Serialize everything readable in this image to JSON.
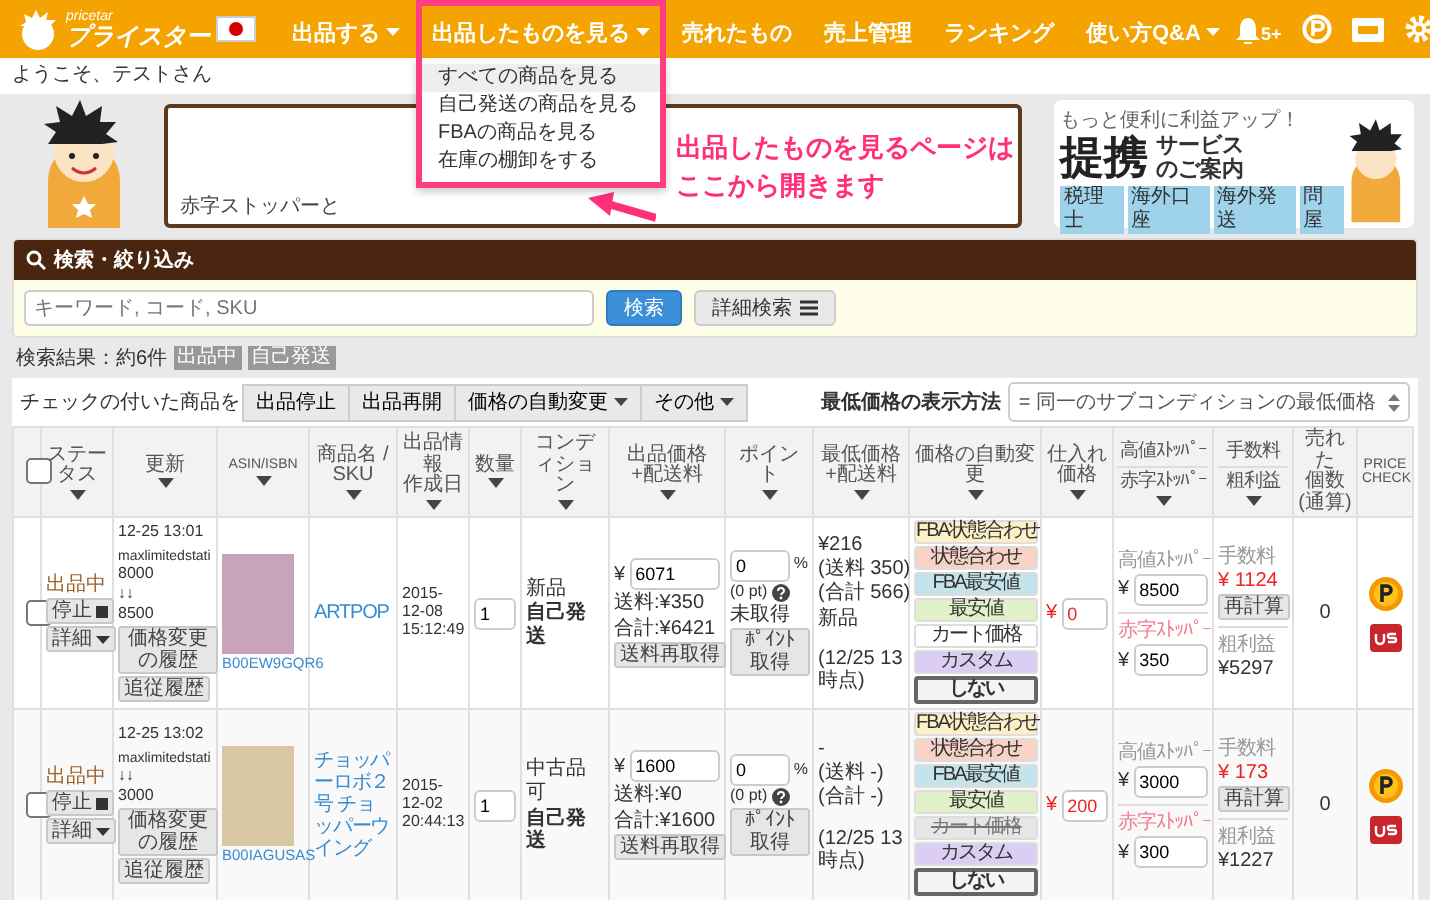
{
  "header": {
    "logo_tag": "pricetar",
    "logo": "プライスター",
    "nav": [
      {
        "label": "出品する",
        "dropdown": true,
        "expanded": false
      },
      {
        "label": "出品したものを見る",
        "dropdown": true,
        "expanded": true,
        "menu": [
          {
            "label": "すべての商品を見る",
            "selected": true
          },
          {
            "label": "自己発送の商品を見る",
            "selected": false
          },
          {
            "label": "FBAの商品を見る",
            "selected": false
          },
          {
            "label": "在庫の棚卸をする",
            "selected": false
          }
        ]
      },
      {
        "label": "売れたもの",
        "dropdown": false,
        "expanded": false
      },
      {
        "label": "売上管理",
        "dropdown": false,
        "expanded": false
      },
      {
        "label": "ランキング",
        "dropdown": false,
        "expanded": false
      },
      {
        "label": "使い方Q&A",
        "dropdown": true,
        "expanded": false
      }
    ],
    "notifications": "5+",
    "welcome": "ようこそ、テストさん"
  },
  "promo": {
    "bubble_text": "赤字ストッパーと",
    "callout": [
      "出品したものを見るページは",
      "ここから開きます"
    ],
    "banner": {
      "tagline": "もっと便利に利益アップ！",
      "title": "提携",
      "subtitle": [
        "サービス",
        "のご案内"
      ],
      "tags": [
        "税理士",
        "海外口座",
        "海外発送",
        "問屋"
      ]
    }
  },
  "search": {
    "title": "検索・絞り込み",
    "placeholder": "キーワード, コード, SKU",
    "search_button": "検索",
    "advanced_button": "詳細検索"
  },
  "results": {
    "count": "検索結果：約6件",
    "filters": [
      "出品中",
      "自己発送"
    ]
  },
  "toolbar": {
    "label": "チェックの付いた商品を",
    "actions": [
      {
        "label": "出品停止",
        "dropdown": false
      },
      {
        "label": "出品再開",
        "dropdown": false
      },
      {
        "label": "価格の自動変更",
        "dropdown": true
      },
      {
        "label": "その他",
        "dropdown": true
      }
    ],
    "display_label": "最低価格の表示方法",
    "display_value": "= 同一のサブコンディションの最低価格"
  },
  "table": {
    "select_all": {
      "checked": false
    },
    "columns": [
      {
        "lines": [
          "ステータス"
        ],
        "sortable": true
      },
      {
        "lines": [
          "更新"
        ],
        "sortable": true
      },
      {
        "lines": [
          "ASIN/ISBN"
        ],
        "sortable": true
      },
      {
        "lines": [
          "商品名 / SKU"
        ],
        "sortable": true
      },
      {
        "lines": [
          "出品情報",
          "作成日"
        ],
        "sortable": true
      },
      {
        "lines": [
          "数量"
        ],
        "sortable": true
      },
      {
        "lines": [
          "コンディション"
        ],
        "sortable": true
      },
      {
        "lines": [
          "出品価格",
          "+配送料"
        ],
        "sortable": true
      },
      {
        "lines": [
          "ポイント"
        ],
        "sortable": true
      },
      {
        "lines": [
          "最低価格",
          "+配送料"
        ],
        "sortable": true
      },
      {
        "lines": [
          "価格の自動変更"
        ],
        "sortable": true
      },
      {
        "lines": [
          "仕入れ価格"
        ],
        "sortable": true
      },
      {
        "labels": [
          "高値ｽﾄｯﾊﾟｰ",
          "赤字ｽﾄｯﾊﾟｰ"
        ],
        "sortable": true
      },
      {
        "labels": [
          "手数料",
          "粗利益"
        ],
        "sortable": true
      },
      {
        "lines": [
          "売れた",
          "個数",
          "(通算)"
        ],
        "sortable": false
      },
      {
        "lines": [
          "PRICE",
          "CHECK"
        ],
        "sortable": false
      }
    ],
    "rows": [
      {
        "checked": false,
        "status": "出品中",
        "stop_button": "停止",
        "detail_button": "詳細",
        "updated": "12-25 13:01",
        "strategy": "maxlimitedstati",
        "price_from": "8000",
        "change_mark": "↓↓",
        "price_to": "8500",
        "history_button": "価格変更の履歴",
        "follow_button": "追従履歴",
        "asin": "B00EW9GQR6",
        "title": "ARTPOP",
        "created": "2015-12-08 15:12:49",
        "quantity": "1",
        "condition": [
          "新品"
        ],
        "fulfillment": "自己発送",
        "price": {
          "currency": "¥",
          "value": "6071",
          "shipping": "送料:¥350",
          "total": "合計:¥6421",
          "button": "送料再取得"
        },
        "point": {
          "value": "0",
          "unit": "%",
          "pt": "(0 pt)",
          "status": "未取得",
          "button": "ﾎﾟｲﾝﾄ取得"
        },
        "lowest": {
          "lines": [
            "¥216",
            "(送料 350)",
            "(合計 566)",
            "新品"
          ],
          "as_of": "(12/25 13時点)"
        },
        "auto": [
          {
            "label": "FBA状態合わせ",
            "color": "#fdf0c8",
            "selected": false,
            "disabled": false
          },
          {
            "label": "状態合わせ",
            "color": "#f6d3c6",
            "selected": false,
            "disabled": false
          },
          {
            "label": "FBA最安値",
            "color": "#c5e3ea",
            "selected": false,
            "disabled": false
          },
          {
            "label": "最安値",
            "color": "#e0f0c8",
            "selected": false,
            "disabled": false
          },
          {
            "label": "カート価格",
            "color": "#ffffff",
            "selected": false,
            "disabled": false
          },
          {
            "label": "カスタム",
            "color": "#dccdf3",
            "selected": false,
            "disabled": false
          },
          {
            "label": "しない",
            "color": "#f4f4f4",
            "selected": true,
            "disabled": false
          }
        ],
        "purchase": {
          "currency": "¥",
          "value": "0"
        },
        "high": {
          "label": "高値ｽﾄｯﾊﾟｰ",
          "currency": "¥",
          "value": "8500"
        },
        "low": {
          "label": "赤字ｽﾄｯﾊﾟｰ",
          "currency": "¥",
          "value": "350"
        },
        "fee": {
          "label": "手数料",
          "value": "¥ 1124",
          "button": "再計算"
        },
        "profit": {
          "label": "粗利益",
          "value": "¥5297"
        },
        "sold": "0"
      },
      {
        "checked": false,
        "status": "出品中",
        "stop_button": "停止",
        "detail_button": "詳細",
        "updated": "12-25 13:02",
        "strategy": "maxlimitedstati",
        "change_mark": "↓↓",
        "price_to": "3000",
        "history_button": "価格変更の履歴",
        "follow_button": "追従履歴",
        "asin": "B00IAGUSAS",
        "title": "チョッパーロボ２号 チョッパーウイング",
        "created": "2015-12-02 20:44:13",
        "quantity": "1",
        "condition": [
          "中古品",
          "可"
        ],
        "fulfillment": "自己発送",
        "price": {
          "currency": "¥",
          "value": "1600",
          "shipping": "送料:¥0",
          "total": "合計:¥1600",
          "button": "送料再取得"
        },
        "point": {
          "value": "0",
          "unit": "%",
          "pt": "(0 pt)",
          "button": "ﾎﾟｲﾝﾄ取得"
        },
        "lowest": {
          "lines": [
            "-",
            "(送料 -)",
            "(合計 -)"
          ],
          "as_of": "(12/25 13時点)"
        },
        "auto": [
          {
            "label": "FBA状態合わせ",
            "color": "#fdf0c8",
            "selected": false,
            "disabled": false
          },
          {
            "label": "状態合わせ",
            "color": "#f6d3c6",
            "selected": false,
            "disabled": false
          },
          {
            "label": "FBA最安値",
            "color": "#c5e3ea",
            "selected": false,
            "disabled": false
          },
          {
            "label": "最安値",
            "color": "#e0f0c8",
            "selected": false,
            "disabled": false
          },
          {
            "label": "カート価格",
            "color": "#e6e6e6",
            "selected": false,
            "disabled": true
          },
          {
            "label": "カスタム",
            "color": "#dccdf3",
            "selected": false,
            "disabled": false
          },
          {
            "label": "しない",
            "color": "#f4f4f4",
            "selected": true,
            "disabled": false
          }
        ],
        "purchase": {
          "currency": "¥",
          "value": "200"
        },
        "high": {
          "label": "高値ｽﾄｯﾊﾟｰ",
          "currency": "¥",
          "value": "3000"
        },
        "low": {
          "label": "赤字ｽﾄｯﾊﾟｰ",
          "currency": "¥",
          "value": "300"
        },
        "fee": {
          "label": "手数料",
          "value": "¥ 173",
          "button": "再計算"
        },
        "profit": {
          "label": "粗利益",
          "value": "¥1227"
        },
        "sold": "0"
      }
    ]
  }
}
